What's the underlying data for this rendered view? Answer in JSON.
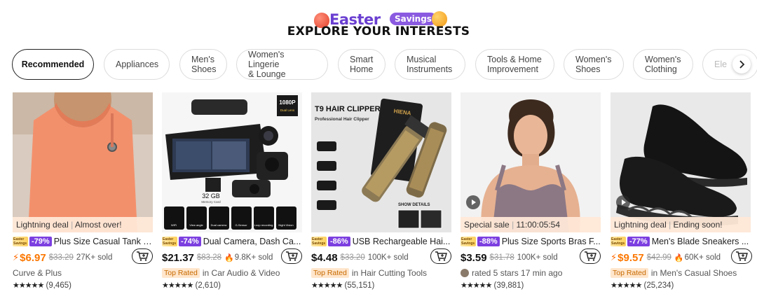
{
  "header": {
    "logo_text": "Easter",
    "logo_pill": "Savings",
    "title": "EXPLORE YOUR INTERESTS"
  },
  "chips": [
    {
      "label": "Recommended",
      "active": true
    },
    {
      "label": "Appliances"
    },
    {
      "label": "Men's\nShoes"
    },
    {
      "label": "Women's Lingerie\n& Lounge"
    },
    {
      "label": "Smart\nHome"
    },
    {
      "label": "Musical\nInstruments"
    },
    {
      "label": "Tools & Home\nImprovement"
    },
    {
      "label": "Women's\nShoes"
    },
    {
      "label": "Women's\nClothing"
    },
    {
      "label": "Ele"
    }
  ],
  "next_icon": "chevron-right-icon",
  "products": [
    {
      "strip_left": "Lightning deal",
      "strip_right": "Almost over!",
      "badge": "Easter Savings",
      "discount": "-79%",
      "title": "Plus Size Casual Tank T...",
      "price": "$6.97",
      "price_orange": true,
      "lightning": true,
      "old_price": "$33.29",
      "sold": "27K+ sold",
      "meta": "Curve & Plus",
      "stars": "★★★★★",
      "reviews": "(9,465)"
    },
    {
      "strip_left": "",
      "strip_right": "",
      "badge": "Easter Savings",
      "discount": "-74%",
      "title": "Dual Camera, Dash Ca...",
      "price": "$21.37",
      "old_price": "$83.28",
      "sold": "9.8K+ sold",
      "flame": true,
      "top_rated": "Top Rated",
      "meta": "in Car Audio & Video",
      "stars": "★★★★★",
      "reviews": "(2,610)",
      "img_text": {
        "res": "1080P",
        "res_sub": "Dual Lens",
        "card": "32 GB",
        "card_sub": "Memory Card",
        "f1": "WiFi",
        "f2": "View angle",
        "f3": "Dual camera",
        "f4": "G-Sensor",
        "f5": "Loop recording",
        "f6": "Night Vision"
      }
    },
    {
      "strip_left": "",
      "strip_right": "",
      "badge": "Easter Savings",
      "discount": "-86%",
      "title": "USB Rechargeable Hai...",
      "price": "$4.48",
      "old_price": "$33.20",
      "sold": "100K+ sold",
      "top_rated": "Top Rated",
      "meta": "in Hair Cutting Tools",
      "stars": "★★★★★",
      "reviews": "(55,151)",
      "img_text": {
        "headline": "T9 HAIR CLIPPER",
        "sub": "Professional Hair Clipper",
        "brand": "HIENA",
        "detail": "SHOW DETAILS"
      }
    },
    {
      "strip_left": "Special sale",
      "strip_right": "11:00:05:54",
      "badge": "Easter Savings",
      "discount": "-88%",
      "title": "Plus Size Sports Bras F...",
      "price": "$3.59",
      "old_price": "$31.78",
      "sold": "100K+ sold",
      "meta": "rated 5 stars 17 min ago",
      "avatar": true,
      "stars": "★★★★★",
      "reviews": "(39,881)"
    },
    {
      "strip_left": "Lightning deal",
      "strip_right": "Ending soon!",
      "badge": "Easter Savings",
      "discount": "-77%",
      "title": "Men's Blade Sneakers ...",
      "price": "$9.57",
      "price_orange": true,
      "lightning": true,
      "old_price": "$42.99",
      "sold": "60K+ sold",
      "flame": true,
      "top_rated": "Top Rated",
      "meta": "in Men's Casual Shoes",
      "stars": "★★★★★",
      "reviews": "(25,234)"
    }
  ],
  "colors": {
    "accent_orange": "#fb7701",
    "discount_purple": "#7c3fe0",
    "strip_bg": "#ffe8d7"
  }
}
